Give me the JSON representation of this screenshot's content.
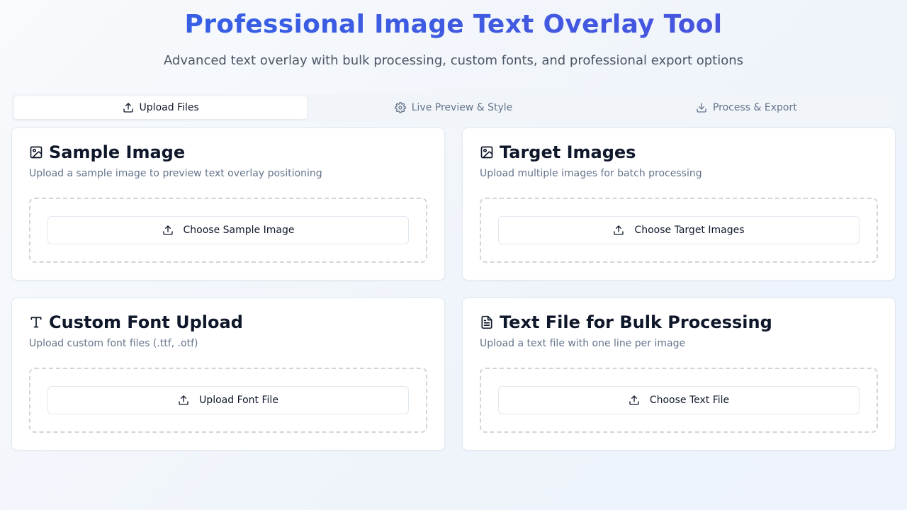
{
  "header": {
    "title": "Professional Image Text Overlay Tool",
    "subtitle": "Advanced text overlay with bulk processing, custom fonts, and professional export options"
  },
  "tabs": [
    {
      "label": "Upload Files",
      "icon": "upload-icon",
      "active": true
    },
    {
      "label": "Live Preview & Style",
      "icon": "gear-icon",
      "active": false
    },
    {
      "label": "Process & Export",
      "icon": "download-icon",
      "active": false
    }
  ],
  "cards": {
    "sample_image": {
      "icon": "image-icon",
      "title": "Sample Image",
      "description": "Upload a sample image to preview text overlay positioning",
      "button_label": "Choose Sample Image"
    },
    "target_images": {
      "icon": "image-icon",
      "title": "Target Images",
      "description": "Upload multiple images for batch processing",
      "button_label": "Choose Target Images"
    },
    "custom_font": {
      "icon": "type-icon",
      "title": "Custom Font Upload",
      "description": "Upload custom font files (.ttf, .otf)",
      "button_label": "Upload Font File"
    },
    "text_file": {
      "icon": "file-text-icon",
      "title": "Text File for Bulk Processing",
      "description": "Upload a text file with one line per image",
      "button_label": "Choose Text File"
    }
  },
  "colors": {
    "title_gradient_start": "#2f62e6",
    "title_gradient_end": "#4b4fdc",
    "background": "#f8fafc"
  }
}
